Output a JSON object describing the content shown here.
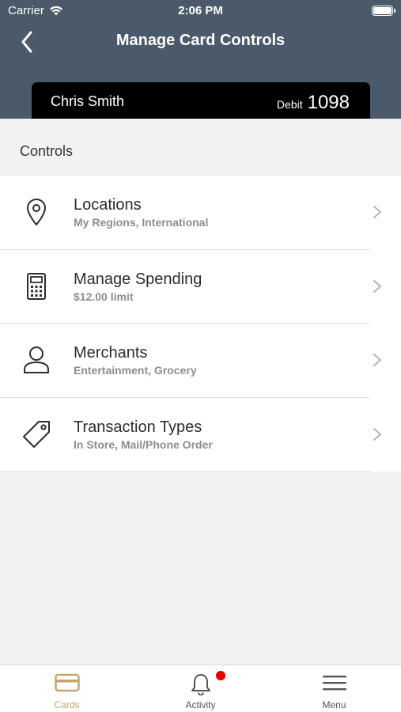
{
  "status_bar": {
    "carrier": "Carrier",
    "time": "2:06 PM"
  },
  "header": {
    "title": "Manage Card Controls",
    "back_icon": "chevron-left-icon"
  },
  "card": {
    "name": "Chris Smith",
    "type": "Debit",
    "last4": "1098"
  },
  "section": {
    "title": "Controls"
  },
  "controls": [
    {
      "title": "Locations",
      "subtitle": "My Regions, International",
      "icon": "location-pin-icon"
    },
    {
      "title": "Manage Spending",
      "subtitle": "$12.00 limit",
      "icon": "calculator-icon"
    },
    {
      "title": "Merchants",
      "subtitle": "Entertainment, Grocery",
      "icon": "person-icon"
    },
    {
      "title": "Transaction Types",
      "subtitle": "In Store, Mail/Phone Order",
      "icon": "tag-icon"
    }
  ],
  "tabbar": {
    "tabs": [
      {
        "label": "Cards",
        "icon": "card-icon",
        "active": true
      },
      {
        "label": "Activity",
        "icon": "bell-icon",
        "active": false,
        "badge": true
      },
      {
        "label": "Menu",
        "icon": "hamburger-icon",
        "active": false
      }
    ]
  },
  "colors": {
    "header_bg": "#4a5a6a",
    "accent": "#c7a36a",
    "badge": "#e60000"
  }
}
